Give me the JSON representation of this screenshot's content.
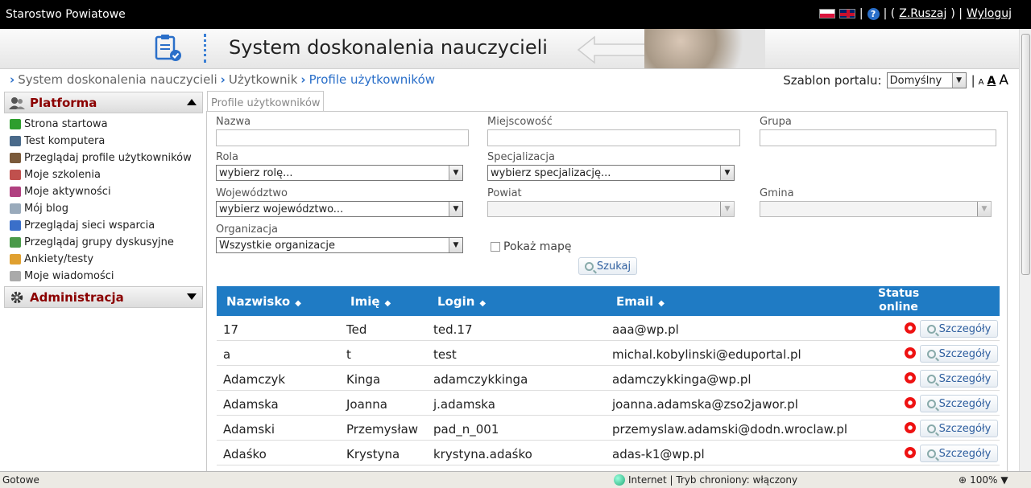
{
  "topbar": {
    "title": "Starostwo Powiatowe",
    "user": "Z.Ruszaj",
    "logout": "Wyloguj",
    "help": "?"
  },
  "banner": {
    "app_title": "System doskonalenia nauczycieli"
  },
  "breadcrumb": [
    "System doskonalenia nauczycieli",
    "Użytkownik",
    "Profile użytkowników"
  ],
  "szablon": {
    "label": "Szablon portalu:",
    "value": "Domyślny",
    "font_small": "A",
    "font_mid": "A",
    "font_large": "A"
  },
  "sidebar": {
    "platforma": "Platforma",
    "administracja": "Administracja",
    "items": [
      {
        "label": "Strona startowa",
        "color": "#2e9e2e"
      },
      {
        "label": "Test komputera",
        "color": "#4a6a8a"
      },
      {
        "label": "Przeglądaj profile użytkowników",
        "color": "#7a5a3a"
      },
      {
        "label": "Moje szkolenia",
        "color": "#c0504d"
      },
      {
        "label": "Moje aktywności",
        "color": "#b04080"
      },
      {
        "label": "Mój blog",
        "color": "#9ab"
      },
      {
        "label": "Przeglądaj sieci wsparcia",
        "color": "#3a6fc9"
      },
      {
        "label": "Przeglądaj grupy dyskusyjne",
        "color": "#4a9a4a"
      },
      {
        "label": "Ankiety/testy",
        "color": "#e0a030"
      },
      {
        "label": "Moje wiadomości",
        "color": "#aaa"
      }
    ]
  },
  "tab": {
    "label": "Profile użytkowników"
  },
  "filters": {
    "nazwa": "Nazwa",
    "miejscowosc": "Miejscowość",
    "grupa": "Grupa",
    "rola": "Rola",
    "rola_value": "wybierz rolę...",
    "specjalizacja": "Specjalizacja",
    "specjalizacja_value": "wybierz specjalizację...",
    "wojewodztwo": "Województwo",
    "wojewodztwo_value": "wybierz województwo...",
    "powiat": "Powiat",
    "gmina": "Gmina",
    "organizacja": "Organizacja",
    "organizacja_value": "Wszystkie organizacje",
    "mapa": "Pokaż mapę",
    "szukaj": "Szukaj"
  },
  "table": {
    "headers": {
      "nazwisko": "Nazwisko",
      "imie": "Imię",
      "login": "Login",
      "email": "Email",
      "status_1": "Status",
      "status_2": "online"
    },
    "details_label": "Szczegóły",
    "rows": [
      {
        "nazwisko": "17",
        "imie": "Ted",
        "login": "ted.17",
        "email": "aaa@wp.pl"
      },
      {
        "nazwisko": "a",
        "imie": "t",
        "login": "test",
        "email": "michal.kobylinski@eduportal.pl"
      },
      {
        "nazwisko": "Adamczyk",
        "imie": "Kinga",
        "login": "adamczykkinga",
        "email": "adamczykkinga@wp.pl"
      },
      {
        "nazwisko": "Adamska",
        "imie": "Joanna",
        "login": "j.adamska",
        "email": "joanna.adamska@zso2jawor.pl"
      },
      {
        "nazwisko": "Adamski",
        "imie": "Przemysław",
        "login": "pad_n_001",
        "email": "przemyslaw.adamski@dodn.wroclaw.pl"
      },
      {
        "nazwisko": "Adaśko",
        "imie": "Krystyna",
        "login": "krystyna.adaśko",
        "email": "adas-k1@wp.pl"
      }
    ]
  },
  "status": {
    "left": "Gotowe",
    "zone": "Internet | Tryb chroniony: włączony",
    "zoom": "100%"
  }
}
